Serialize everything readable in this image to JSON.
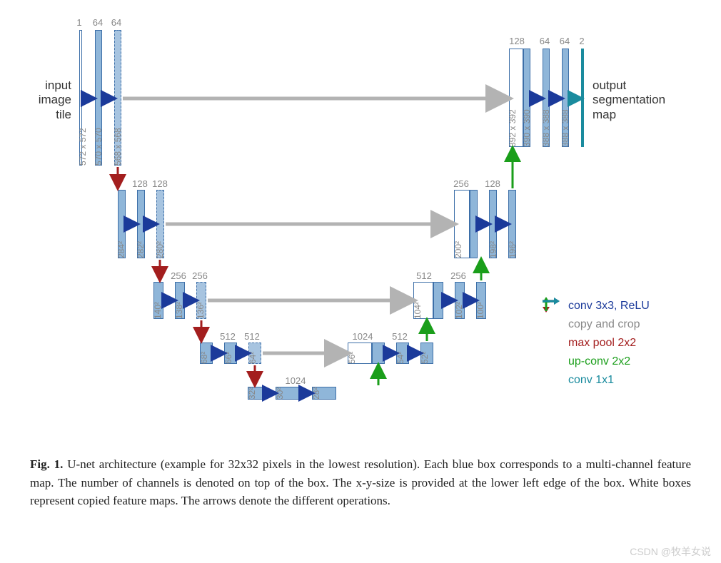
{
  "chart_data": {
    "type": "diagram",
    "title": "U-net architecture",
    "encoder": [
      {
        "level": 0,
        "channels": [
          1,
          64,
          64
        ],
        "sizes": [
          "572 x 572",
          "570 x 570",
          "568 x 568"
        ]
      },
      {
        "level": 1,
        "channels": [
          128,
          128
        ],
        "sizes": [
          "284²",
          "282²",
          "280²"
        ]
      },
      {
        "level": 2,
        "channels": [
          256,
          256
        ],
        "sizes": [
          "140²",
          "138²",
          "136²"
        ]
      },
      {
        "level": 3,
        "channels": [
          512,
          512
        ],
        "sizes": [
          "68²",
          "66²",
          "64²"
        ]
      },
      {
        "level": 4,
        "channels": [
          1024,
          1024
        ],
        "sizes": [
          "32²",
          "30²",
          "28²"
        ]
      }
    ],
    "decoder": [
      {
        "level": 3,
        "channels": [
          1024,
          512,
          512
        ],
        "sizes": [
          "56²",
          "54²",
          "52²"
        ]
      },
      {
        "level": 2,
        "channels": [
          512,
          256,
          256
        ],
        "sizes": [
          "104²",
          "102²",
          "100²"
        ]
      },
      {
        "level": 1,
        "channels": [
          256,
          128,
          128
        ],
        "sizes": [
          "200²",
          "198²",
          "196²"
        ]
      },
      {
        "level": 0,
        "channels": [
          128,
          64,
          64,
          2
        ],
        "sizes": [
          "392 x 392",
          "390 x 390",
          "388 x 388",
          "388 x 388"
        ]
      }
    ],
    "legend": {
      "conv": "conv 3x3, ReLU",
      "copy": "copy and crop",
      "pool": "max pool 2x2",
      "up": "up-conv 2x2",
      "conv1": "conv 1x1"
    }
  },
  "labels": {
    "input": "input\nimage\ntile",
    "output": "output\nsegmentation\nmap"
  },
  "ch": {
    "e0a": "1",
    "e0b": "64",
    "e0c": "64",
    "e1a": "128",
    "e1b": "128",
    "e2a": "256",
    "e2b": "256",
    "e3a": "512",
    "e3b": "512",
    "e4a": "1024",
    "d3w": "1024",
    "d3a": "512",
    "d2w": "512",
    "d2a": "256",
    "d1w": "256",
    "d1a": "128",
    "d0w": "128",
    "d0a": "64",
    "d0b": "64",
    "d0c": "2"
  },
  "dim": {
    "e0a": "572 x 572",
    "e0b": "570 x 570",
    "e0c": "568 x 568",
    "e1a": "284²",
    "e1b": "282²",
    "e1c": "280²",
    "e2a": "140²",
    "e2b": "138²",
    "e2c": "136²",
    "e3a": "68²",
    "e3b": "66²",
    "e3c": "64²",
    "e4a": "32²",
    "e4b": "30²",
    "e4c": "28²",
    "d3w": "56²",
    "d3a": "54²",
    "d3b": "52²",
    "d2w": "104²",
    "d2a": "102²",
    "d2b": "100²",
    "d1w": "200²",
    "d1a": "198²",
    "d1b": "196²",
    "d0w": "392 x 392",
    "d0a": "390 x 390",
    "d0b": "388 x 388",
    "d0c": "388 x 388"
  },
  "legend": {
    "conv": "conv 3x3, ReLU",
    "copy": "copy and crop",
    "pool": "max pool 2x2",
    "up": "up-conv 2x2",
    "conv1": "conv 1x1"
  },
  "caption": {
    "fig": "Fig. 1.",
    "text": " U-net architecture (example for 32x32 pixels in the lowest resolution). Each blue box corresponds to a multi-channel feature map. The number of channels is denoted on top of the box. The x-y-size is provided at the lower left edge of the box. White boxes represent copied feature maps. The arrows denote the different operations."
  },
  "watermark": "CSDN @牧羊女说"
}
